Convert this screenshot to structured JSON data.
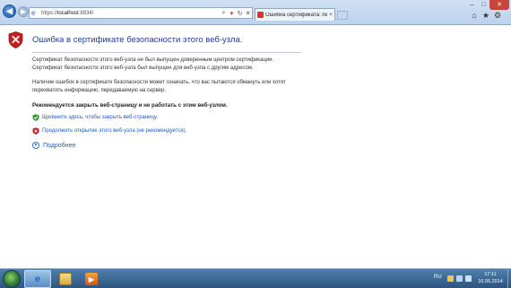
{
  "address_bar": {
    "url_prefix": "https://",
    "url_host": "localhost",
    "url_rest": ":8834/",
    "tools": [
      "search-icon",
      "lock-icon",
      "refresh-icon",
      "close-icon"
    ]
  },
  "tab": {
    "title": "Ошибка сертификата: пер...",
    "close": "×"
  },
  "window": {
    "minimize": "–",
    "maximize": "□",
    "close": "✕"
  },
  "page": {
    "title": "Ошибка в сертификате безопасности этого веб-узла.",
    "para1_line1": "Сертификат безопасности этого веб-узла не был выпущен доверенным центром сертификации.",
    "para1_line2": "Сертификат безопасности этого веб-узла был выпущен для веб-узла с другим адресом.",
    "para2_line1": "Наличие ошибок в сертификате безопасности может означать, что вас пытаются обмануть или хотят",
    "para2_line2": "перехватить информацию, передаваемую на сервер.",
    "recommendation": "Рекомендуется закрыть веб-страницу и не работать с этим веб-узлом.",
    "close_link": "Щелкните здесь, чтобы закрыть веб-страницу.",
    "continue_link": "Продолжить открытие этого веб-узла (не рекомендуется).",
    "more_info": "Подробнее"
  },
  "taskbar": {
    "language": "RU",
    "time": "17:11",
    "date": "16.05.2014"
  },
  "colors": {
    "title_blue": "#1f3f8f",
    "link_blue": "#1f5cc8",
    "error_red": "#c81e1e",
    "safe_green": "#3a9a3a"
  }
}
